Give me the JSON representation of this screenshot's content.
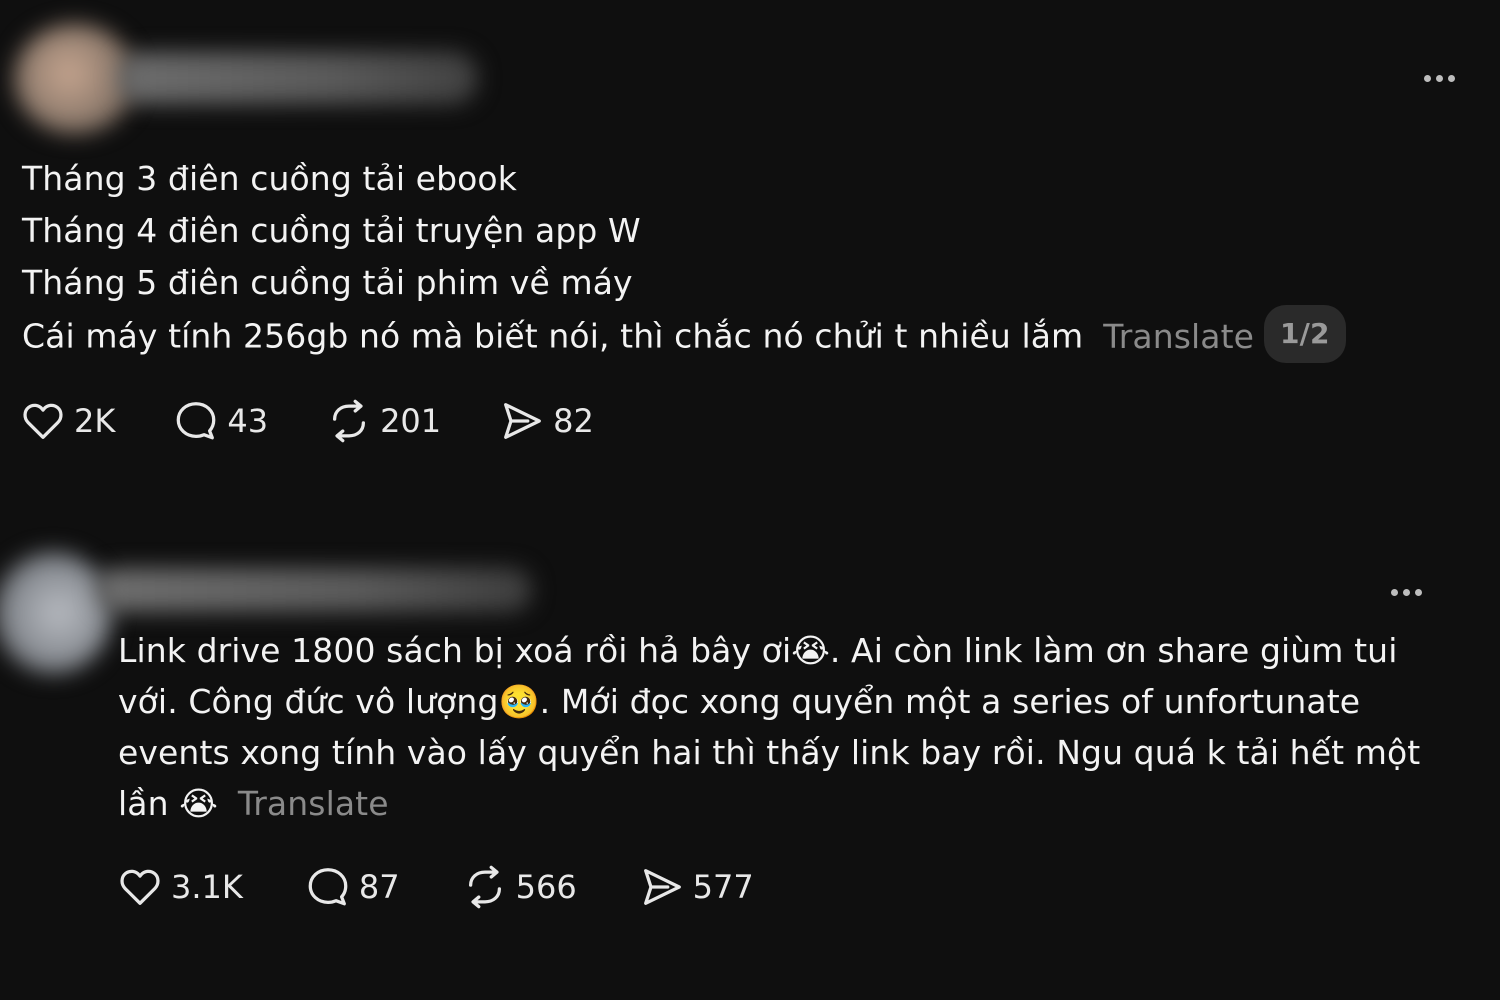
{
  "posts": [
    {
      "lines": [
        "Tháng 3 điên cuồng tải ebook",
        "Tháng 4 điên cuồng tải truyện app W",
        "Tháng 5 điên cuồng tải phim về máy",
        "Cái máy tính 256gb nó mà biết nói, thì chắc nó chửi t nhiều lắm"
      ],
      "translate_label": "Translate",
      "pager": "1/2",
      "likes": "2K",
      "comments": "43",
      "reposts": "201",
      "shares": "82"
    },
    {
      "lines": [
        "Link drive 1800 sách bị xoá rồi hả bây ơi😭. Ai còn link làm ơn share giùm tui",
        "với. Công đức vô lượng🥹. Mới đọc xong quyển một a series of unfortunate",
        "events xong tính vào lấy quyển hai thì thấy link bay rồi. Ngu quá k tải hết một",
        "lần 😭"
      ],
      "translate_label": "Translate",
      "likes": "3.1K",
      "comments": "87",
      "reposts": "566",
      "shares": "577"
    }
  ],
  "icons": {
    "like": "heart-icon",
    "comment": "comment-bubble-icon",
    "repost": "repost-icon",
    "share": "send-icon",
    "more": "more-options-icon"
  },
  "colors": {
    "background": "#0f0f0f",
    "text": "#f3f3f3",
    "muted": "#8a8a8a"
  }
}
